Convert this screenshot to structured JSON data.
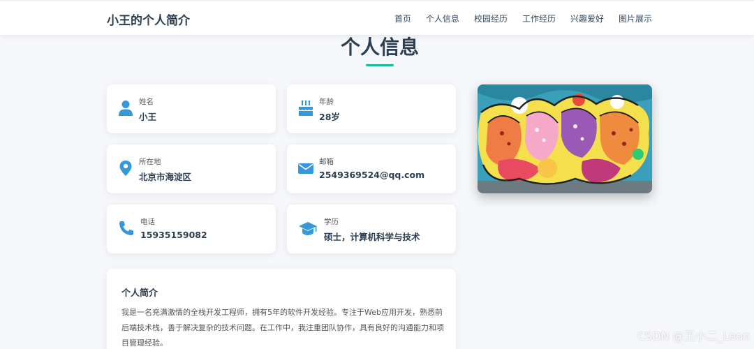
{
  "navbar": {
    "brand": "小王的个人简介",
    "links": [
      "首页",
      "个人信息",
      "校园经历",
      "工作经历",
      "兴趣爱好",
      "图片展示"
    ]
  },
  "section": {
    "title": "个人信息"
  },
  "info_cards": [
    {
      "label": "姓名",
      "value": "小王",
      "icon": "user-icon"
    },
    {
      "label": "年龄",
      "value": "28岁",
      "icon": "birthday-cake-icon"
    },
    {
      "label": "所在地",
      "value": "北京市海淀区",
      "icon": "map-marker-icon"
    },
    {
      "label": "邮箱",
      "value": "2549369524@qq.com",
      "icon": "envelope-icon"
    },
    {
      "label": "电话",
      "value": "15935159082",
      "icon": "phone-icon"
    },
    {
      "label": "学历",
      "value": "硕士，计算机科学与技术",
      "icon": "graduation-cap-icon"
    }
  ],
  "bio": {
    "title": "个人简介",
    "text": "我是一名充满激情的全栈开发工程师，拥有5年的软件开发经验。专注于Web应用开发，熟悉前后端技术栈，善于解决复杂的技术问题。在工作中，我注重团队协作，具有良好的沟通能力和项目管理经验。"
  },
  "watermark": "CSDN @王小二_Leon",
  "colors": {
    "accent": "#1abc9c",
    "icon": "#3498db",
    "text": "#2c3e50",
    "background": "#f5f7fa"
  }
}
